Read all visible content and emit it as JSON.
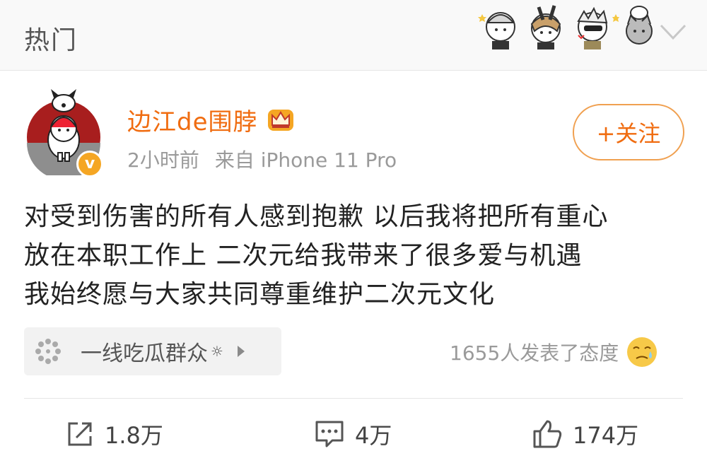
{
  "header": {
    "title": "热门"
  },
  "post": {
    "author": {
      "name": "边江de围脖",
      "verified_mark": "v"
    },
    "meta": {
      "time": "2小时前",
      "source": "来自 iPhone 11 Pro"
    },
    "follow_label": "+关注",
    "content": {
      "lines": [
        "对受到伤害的所有人感到抱歉 以后我将把所有重心",
        "放在本职工作上 二次元给我带来了很多爱与机遇",
        "我始终愿与大家共同尊重维护二次元文化"
      ]
    },
    "topic": {
      "label": "一线吃瓜群众",
      "suffix": "☼"
    },
    "reactions_text": "1655人发表了态度",
    "actions": {
      "share": "1.8万",
      "comment": "4万",
      "like": "174万"
    }
  },
  "colors": {
    "accent": "#f06c10",
    "follow_border": "#f0a050",
    "verified": "#f5a623",
    "header_bg": "#f9f9f9",
    "meta_text": "#9a9a9a"
  },
  "icons": {
    "header_stickers": "cartoon-stickers",
    "dropdown": "chevron-down-icon",
    "crown": "crown-icon",
    "topic": "dot-cluster-icon",
    "emoji": "crying-face-icon",
    "share": "share-icon",
    "comment": "comment-icon",
    "like": "thumbs-up-icon"
  }
}
